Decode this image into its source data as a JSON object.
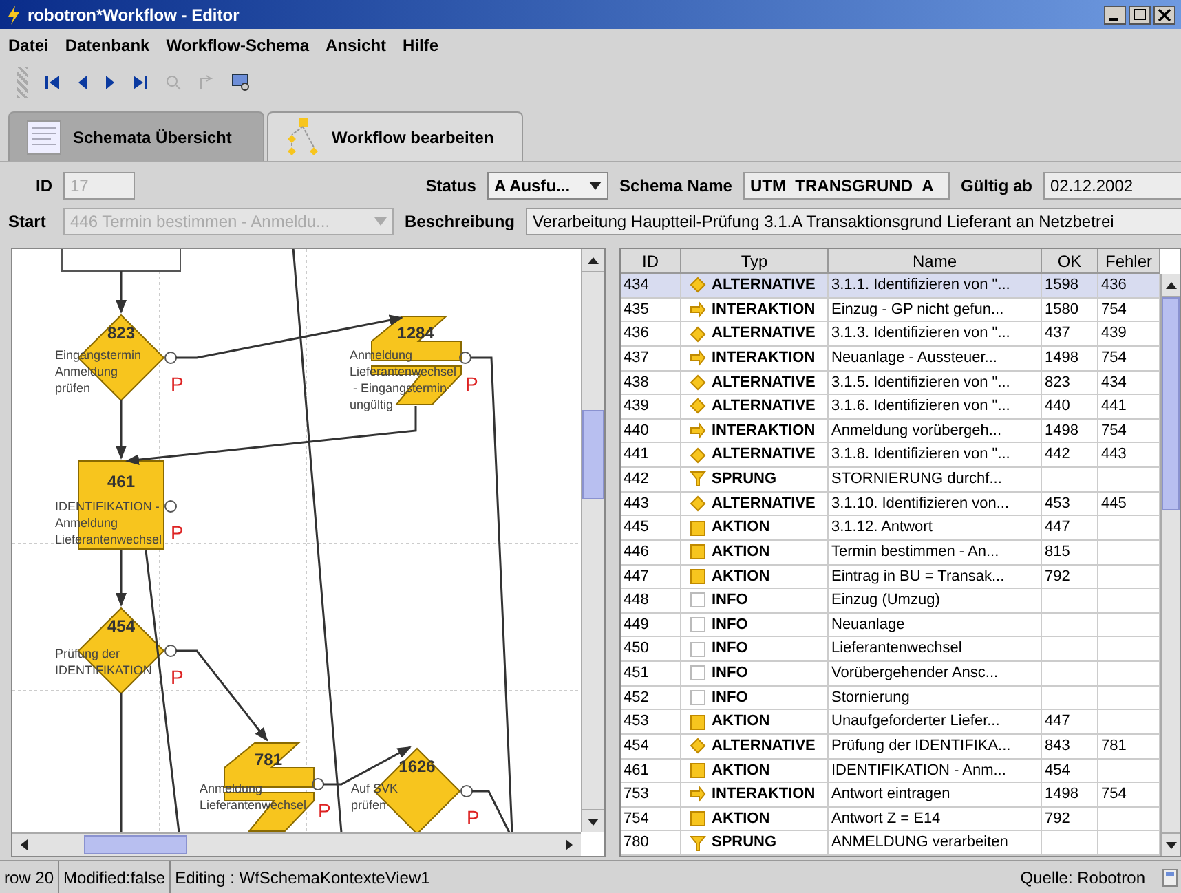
{
  "window": {
    "title": "robotron*Workflow - Editor"
  },
  "menu": [
    "Datei",
    "Datenbank",
    "Workflow-Schema",
    "Ansicht",
    "Hilfe"
  ],
  "tabs": [
    {
      "label": "Schemata Übersicht",
      "selected": false
    },
    {
      "label": "Workflow bearbeiten",
      "selected": true
    }
  ],
  "form": {
    "id_label": "ID",
    "id_value": "17",
    "status_label": "Status",
    "status_value": "A Ausfu...",
    "schema_label": "Schema Name",
    "schema_value": "UTM_TRANSGRUND_A_",
    "valid_label": "Gültig ab",
    "valid_value": "02.12.2002",
    "start_label": "Start",
    "start_value": "446 Termin bestimmen - Anmeldu...",
    "desc_label": "Beschreibung",
    "desc_value": "Verarbeitung Hauptteil-Prüfung 3.1.A Transaktionsgrund Lieferant an Netzbetrei"
  },
  "diagram": {
    "nodes": [
      {
        "kind": "alternative",
        "number": "823",
        "lines": [
          "Eingangstermin",
          "Anmeldung",
          "prüfen"
        ],
        "flag": "P"
      },
      {
        "kind": "interaktion",
        "number": "1284",
        "lines": [
          "Anmeldung",
          "Lieferantenwechsel",
          " - Eingangstermin",
          "ungültig"
        ],
        "flag": "P"
      },
      {
        "kind": "aktion",
        "number": "461",
        "lines": [
          "IDENTIFIKATION -",
          "Anmeldung",
          "Lieferantenwechsel"
        ],
        "flag": "P"
      },
      {
        "kind": "alternative",
        "number": "454",
        "lines": [
          "Prüfung der",
          "IDENTIFIKATION"
        ],
        "flag": "P"
      },
      {
        "kind": "interaktion",
        "number": "781",
        "lines": [
          "Anmeldung",
          "Lieferantenwechsel"
        ],
        "flag": "P"
      },
      {
        "kind": "alternative",
        "number": "1626",
        "lines": [
          "Auf SVK",
          "prüfen"
        ],
        "flag": "P"
      }
    ]
  },
  "table": {
    "columns": [
      "ID",
      "Typ",
      "Name",
      "OK",
      "Fehler"
    ],
    "rows": [
      {
        "id": "434",
        "kind": "alternative",
        "type": "ALTERNATIVE",
        "name": "3.1.1. Identifizieren von \"...",
        "ok": "1598",
        "error": "436",
        "selected": true
      },
      {
        "id": "435",
        "kind": "interaktion",
        "type": "INTERAKTION",
        "name": "Einzug - GP nicht gefun...",
        "ok": "1580",
        "error": "754",
        "selected": false
      },
      {
        "id": "436",
        "kind": "alternative",
        "type": "ALTERNATIVE",
        "name": "3.1.3. Identifizieren von \"...",
        "ok": "437",
        "error": "439",
        "selected": false
      },
      {
        "id": "437",
        "kind": "interaktion",
        "type": "INTERAKTION",
        "name": "Neuanlage - Aussteuer...",
        "ok": "1498",
        "error": "754",
        "selected": false
      },
      {
        "id": "438",
        "kind": "alternative",
        "type": "ALTERNATIVE",
        "name": "3.1.5. Identifizieren von \"...",
        "ok": "823",
        "error": "434",
        "selected": false
      },
      {
        "id": "439",
        "kind": "alternative",
        "type": "ALTERNATIVE",
        "name": "3.1.6. Identifizieren von \"...",
        "ok": "440",
        "error": "441",
        "selected": false
      },
      {
        "id": "440",
        "kind": "interaktion",
        "type": "INTERAKTION",
        "name": "Anmeldung vorübergeh...",
        "ok": "1498",
        "error": "754",
        "selected": false
      },
      {
        "id": "441",
        "kind": "alternative",
        "type": "ALTERNATIVE",
        "name": "3.1.8. Identifizieren von \"...",
        "ok": "442",
        "error": "443",
        "selected": false
      },
      {
        "id": "442",
        "kind": "sprung",
        "type": "SPRUNG",
        "name": "STORNIERUNG durchf...",
        "ok": "",
        "error": "",
        "selected": false
      },
      {
        "id": "443",
        "kind": "alternative",
        "type": "ALTERNATIVE",
        "name": "3.1.10. Identifizieren von...",
        "ok": "453",
        "error": "445",
        "selected": false
      },
      {
        "id": "445",
        "kind": "aktion",
        "type": "AKTION",
        "name": "3.1.12.  Antwort",
        "ok": "447",
        "error": "",
        "selected": false
      },
      {
        "id": "446",
        "kind": "aktion",
        "type": "AKTION",
        "name": "Termin bestimmen - An...",
        "ok": "815",
        "error": "",
        "selected": false
      },
      {
        "id": "447",
        "kind": "aktion",
        "type": "AKTION",
        "name": "Eintrag in BU = Transak...",
        "ok": "792",
        "error": "",
        "selected": false
      },
      {
        "id": "448",
        "kind": "info",
        "type": "INFO",
        "name": "Einzug (Umzug)",
        "ok": "",
        "error": "",
        "selected": false
      },
      {
        "id": "449",
        "kind": "info",
        "type": "INFO",
        "name": "Neuanlage",
        "ok": "",
        "error": "",
        "selected": false
      },
      {
        "id": "450",
        "kind": "info",
        "type": "INFO",
        "name": "Lieferantenwechsel",
        "ok": "",
        "error": "",
        "selected": false
      },
      {
        "id": "451",
        "kind": "info",
        "type": "INFO",
        "name": "Vorübergehender Ansc...",
        "ok": "",
        "error": "",
        "selected": false
      },
      {
        "id": "452",
        "kind": "info",
        "type": "INFO",
        "name": "Stornierung",
        "ok": "",
        "error": "",
        "selected": false
      },
      {
        "id": "453",
        "kind": "aktion",
        "type": "AKTION",
        "name": "Unaufgeforderter Liefer...",
        "ok": "447",
        "error": "",
        "selected": false
      },
      {
        "id": "454",
        "kind": "alternative",
        "type": "ALTERNATIVE",
        "name": "Prüfung der IDENTIFIKA...",
        "ok": "843",
        "error": "781",
        "selected": false
      },
      {
        "id": "461",
        "kind": "aktion",
        "type": "AKTION",
        "name": "IDENTIFIKATION - Anm...",
        "ok": "454",
        "error": "",
        "selected": false
      },
      {
        "id": "753",
        "kind": "interaktion",
        "type": "INTERAKTION",
        "name": "Antwort eintragen",
        "ok": "1498",
        "error": "754",
        "selected": false
      },
      {
        "id": "754",
        "kind": "aktion",
        "type": "AKTION",
        "name": "Antwort Z = E14",
        "ok": "792",
        "error": "",
        "selected": false
      },
      {
        "id": "780",
        "kind": "sprung",
        "type": "SPRUNG",
        "name": "ANMELDUNG verarbeiten",
        "ok": "",
        "error": "",
        "selected": false
      }
    ]
  },
  "status_bar": {
    "row": "row 20",
    "modified": "Modified:false",
    "editing": "Editing : WfSchemaKontexteView1",
    "source": "Quelle: Robotron"
  }
}
